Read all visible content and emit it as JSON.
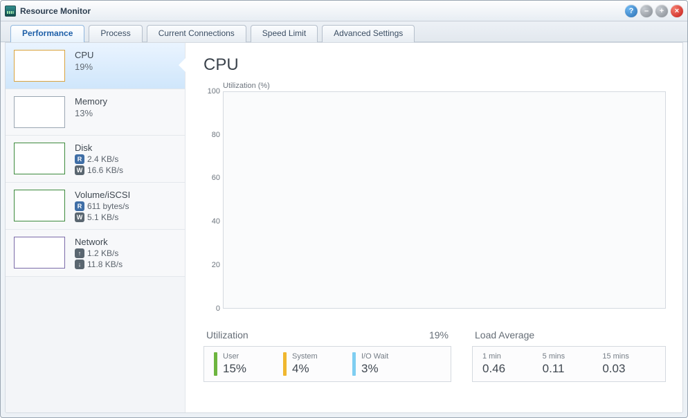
{
  "window": {
    "title": "Resource Monitor"
  },
  "tabs": [
    {
      "label": "Performance",
      "active": true
    },
    {
      "label": "Process"
    },
    {
      "label": "Current Connections"
    },
    {
      "label": "Speed Limit"
    },
    {
      "label": "Advanced Settings"
    }
  ],
  "sidebar": {
    "cpu": {
      "name": "CPU",
      "value": "19%"
    },
    "memory": {
      "name": "Memory",
      "value": "13%"
    },
    "disk": {
      "name": "Disk",
      "read": "2.4 KB/s",
      "write": "16.6 KB/s",
      "r_badge": "R",
      "w_badge": "W"
    },
    "volume": {
      "name": "Volume/iSCSI",
      "read": "611 bytes/s",
      "write": "5.1 KB/s",
      "r_badge": "R",
      "w_badge": "W"
    },
    "network": {
      "name": "Network",
      "up": "1.2 KB/s",
      "down": "11.8 KB/s"
    }
  },
  "main": {
    "title": "CPU",
    "chart": {
      "axis_label": "Utilization (%)",
      "ticks": {
        "t100": "100",
        "t80": "80",
        "t60": "60",
        "t40": "40",
        "t20": "20",
        "t0": "0"
      }
    },
    "utilization": {
      "heading": "Utilization",
      "total": "19%",
      "user_label": "User",
      "user_value": "15%",
      "system_label": "System",
      "system_value": "4%",
      "io_label": "I/O Wait",
      "io_value": "3%"
    },
    "load": {
      "heading": "Load Average",
      "m1_label": "1 min",
      "m1_value": "0.46",
      "m5_label": "5 mins",
      "m5_value": "0.11",
      "m15_label": "15 mins",
      "m15_value": "0.03"
    }
  },
  "chart_data": {
    "type": "line",
    "title": "CPU",
    "ylabel": "Utilization (%)",
    "ylim": [
      0,
      100
    ],
    "y_ticks": [
      0,
      20,
      40,
      60,
      80,
      100
    ],
    "series": [
      {
        "name": "CPU Utilization",
        "values": []
      }
    ],
    "note": "No visible data points plotted in the captured frame; chart area is empty."
  }
}
